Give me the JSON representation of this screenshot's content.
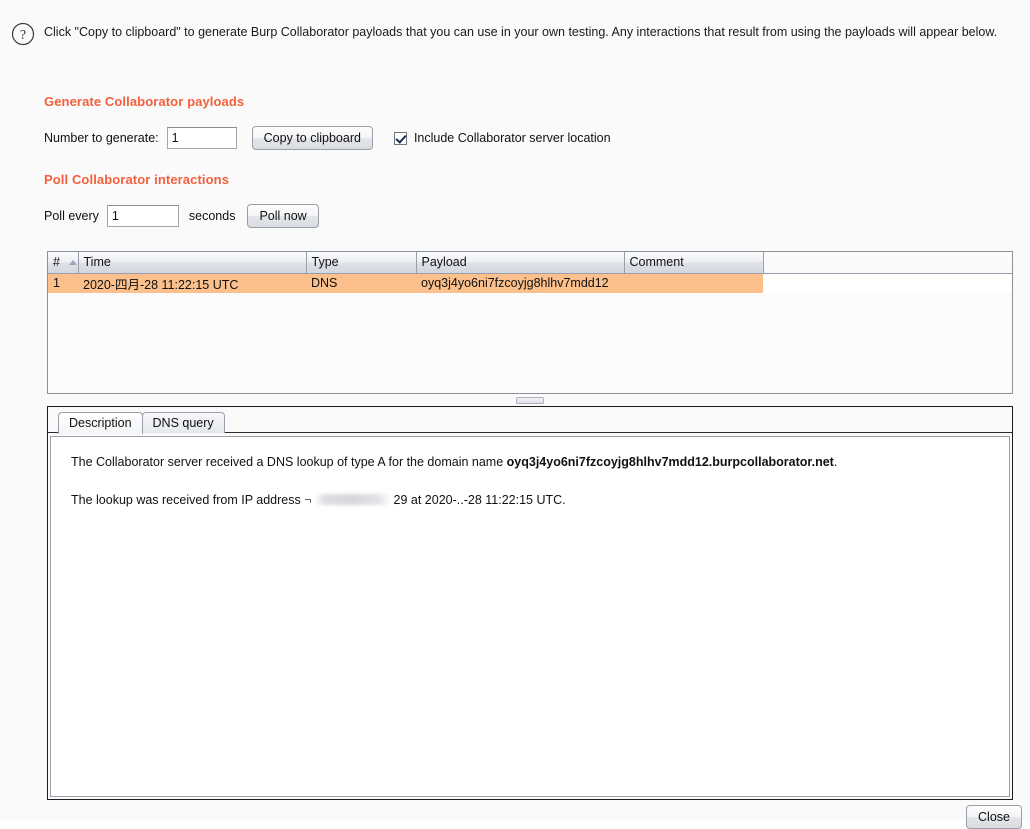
{
  "intro": {
    "icon": "question-circle-icon",
    "text": "Click \"Copy to clipboard\" to generate Burp Collaborator payloads that you can use in your own testing. Any interactions that result from using the payloads will appear below."
  },
  "generate_section": {
    "heading": "Generate Collaborator payloads",
    "number_label": "Number to generate:",
    "number_value": "1",
    "copy_button": "Copy to clipboard",
    "include_location_label": "Include Collaborator server location",
    "include_location_checked": true
  },
  "poll_section": {
    "heading": "Poll Collaborator interactions",
    "poll_every_label": "Poll every",
    "poll_value": "1",
    "seconds_label": "seconds",
    "poll_button": "Poll now"
  },
  "interactions_table": {
    "columns": [
      "#",
      "Time",
      "Type",
      "Payload",
      "Comment"
    ],
    "sorted_column": "#",
    "sort_direction": "ascending",
    "rows": [
      {
        "num": "1",
        "time": "2020-四月-28 11:22:15 UTC",
        "type": "DNS",
        "payload": "oyq3j4yo6ni7fzcoyjg8hlhv7mdd12",
        "comment": "",
        "selected": true
      }
    ]
  },
  "detail_tabs": {
    "tabs": [
      {
        "label": "Description",
        "active": true
      },
      {
        "label": "DNS query",
        "active": false
      }
    ]
  },
  "description": {
    "line1_prefix": "The Collaborator server received a DNS lookup of type A for the domain name ",
    "line1_domain": "oyq3j4yo6ni7fzcoyjg8hlhv7mdd12.burpcollaborator.net",
    "line1_suffix": ".",
    "line2_prefix": "The lookup was received from IP address ",
    "line2_redacted_marker": "¬",
    "line2_ip_tail": "29",
    "line2_suffix": " at 2020-..-28 11:22:15 UTC."
  },
  "footer": {
    "close_button": "Close"
  },
  "colors": {
    "heading_orange": "#f4603c",
    "selected_row": "#fbc08b",
    "panel_border": "#8c9099",
    "page_background": "#fafafa"
  }
}
